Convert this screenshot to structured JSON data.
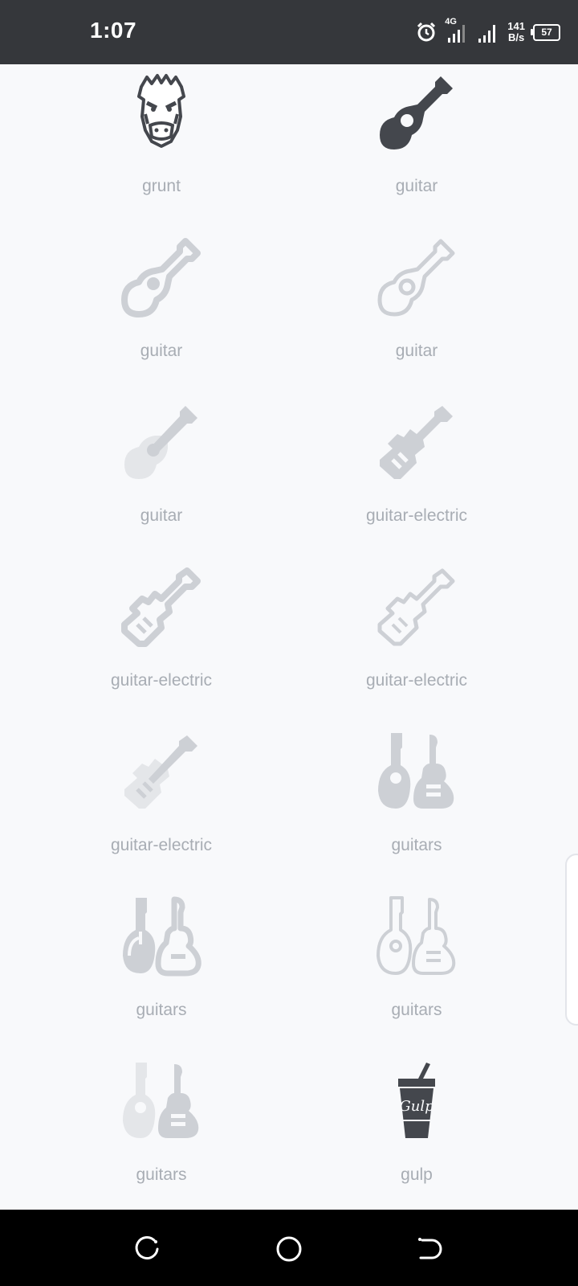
{
  "status_bar": {
    "time": "1:07",
    "network_type": "4G",
    "speed_value": "141",
    "speed_unit": "B/s",
    "battery": "57"
  },
  "icons": [
    {
      "label": "grunt",
      "icon": "grunt-icon"
    },
    {
      "label": "guitar",
      "icon": "guitar-solid-icon"
    },
    {
      "label": "guitar",
      "icon": "guitar-regular-icon"
    },
    {
      "label": "guitar",
      "icon": "guitar-light-icon"
    },
    {
      "label": "guitar",
      "icon": "guitar-duotone-icon"
    },
    {
      "label": "guitar-electric",
      "icon": "guitar-electric-solid-icon"
    },
    {
      "label": "guitar-electric",
      "icon": "guitar-electric-regular-icon"
    },
    {
      "label": "guitar-electric",
      "icon": "guitar-electric-light-icon"
    },
    {
      "label": "guitar-electric",
      "icon": "guitar-electric-duotone-icon"
    },
    {
      "label": "guitars",
      "icon": "guitars-solid-icon"
    },
    {
      "label": "guitars",
      "icon": "guitars-regular-icon"
    },
    {
      "label": "guitars",
      "icon": "guitars-light-icon"
    },
    {
      "label": "guitars",
      "icon": "guitars-duotone-icon"
    },
    {
      "label": "gulp",
      "icon": "gulp-icon"
    }
  ],
  "colors": {
    "dark_icon": "#44474d",
    "muted_icon": "#cdd0d5",
    "faint_icon": "#e4e6e9",
    "label": "#a8adb4"
  }
}
